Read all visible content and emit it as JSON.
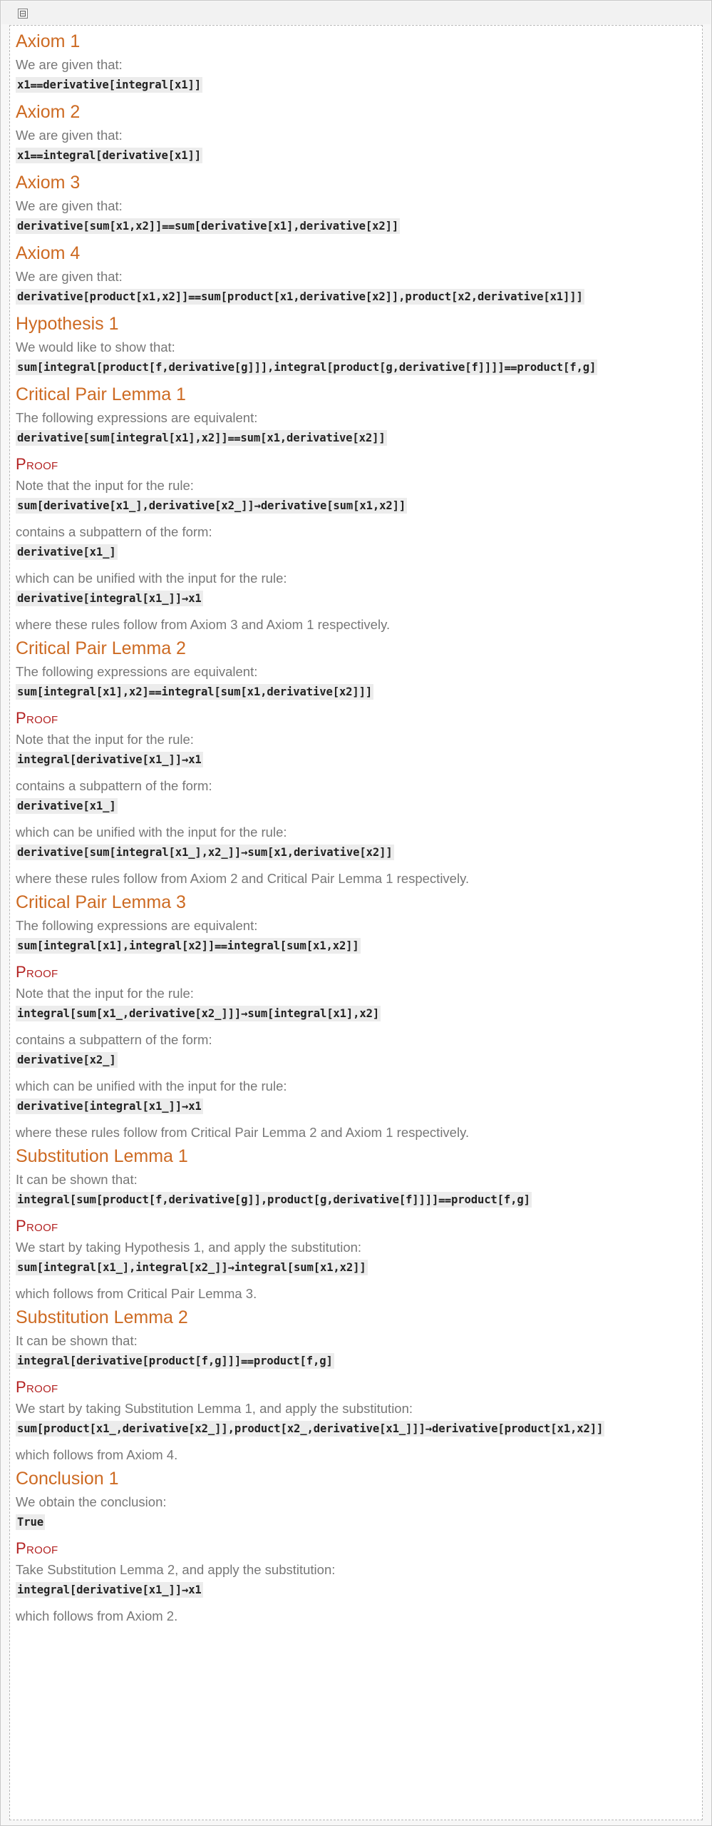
{
  "toolbar": {
    "icon": "cell-bracket-toggle-icon",
    "glyph": "⊟"
  },
  "sections": [
    {
      "title": "Axiom 1",
      "intro": "We are given that:",
      "expr": "x1⩵derivative[integral[x1]]"
    },
    {
      "title": "Axiom 2",
      "intro": "We are given that:",
      "expr": "x1⩵integral[derivative[x1]]"
    },
    {
      "title": "Axiom 3",
      "intro": "We are given that:",
      "expr": "derivative[sum[x1,x2]]⩵sum[derivative[x1],derivative[x2]]"
    },
    {
      "title": "Axiom 4",
      "intro": "We are given that:",
      "expr": "derivative[product[x1,x2]]⩵sum[product[x1,derivative[x2]],product[x2,derivative[x1]]]"
    },
    {
      "title": "Hypothesis 1",
      "intro": "We would like to show that:",
      "expr": "sum[integral[product[f,derivative[g]]],integral[product[g,derivative[f]]]]⩵product[f,g]"
    },
    {
      "title": "Critical Pair Lemma 1",
      "intro": "The following expressions are equivalent:",
      "expr": "derivative[sum[integral[x1],x2]]⩵sum[x1,derivative[x2]]",
      "proof_label": "Proof",
      "proof": [
        {
          "kind": "text",
          "value": "Note that the input for the rule:"
        },
        {
          "kind": "code",
          "value": "sum[derivative[x1_],derivative[x2_]]→derivative[sum[x1,x2]]"
        },
        {
          "kind": "text",
          "value": "contains a subpattern of the form:"
        },
        {
          "kind": "code",
          "value": "derivative[x1_]"
        },
        {
          "kind": "text",
          "value": "which can be unified with the input for the rule:"
        },
        {
          "kind": "code",
          "value": "derivative[integral[x1_]]→x1"
        },
        {
          "kind": "text",
          "value": "where these rules follow from Axiom 3 and Axiom 1 respectively."
        }
      ]
    },
    {
      "title": "Critical Pair Lemma 2",
      "intro": "The following expressions are equivalent:",
      "expr": "sum[integral[x1],x2]⩵integral[sum[x1,derivative[x2]]]",
      "proof_label": "Proof",
      "proof": [
        {
          "kind": "text",
          "value": "Note that the input for the rule:"
        },
        {
          "kind": "code",
          "value": "integral[derivative[x1_]]→x1"
        },
        {
          "kind": "text",
          "value": "contains a subpattern of the form:"
        },
        {
          "kind": "code",
          "value": "derivative[x1_]"
        },
        {
          "kind": "text",
          "value": "which can be unified with the input for the rule:"
        },
        {
          "kind": "code",
          "value": "derivative[sum[integral[x1_],x2_]]→sum[x1,derivative[x2]]"
        },
        {
          "kind": "text",
          "value": "where these rules follow from Axiom 2 and Critical Pair Lemma 1 respectively."
        }
      ]
    },
    {
      "title": "Critical Pair Lemma 3",
      "intro": "The following expressions are equivalent:",
      "expr": "sum[integral[x1],integral[x2]]⩵integral[sum[x1,x2]]",
      "proof_label": "Proof",
      "proof": [
        {
          "kind": "text",
          "value": "Note that the input for the rule:"
        },
        {
          "kind": "code",
          "value": "integral[sum[x1_,derivative[x2_]]]→sum[integral[x1],x2]"
        },
        {
          "kind": "text",
          "value": "contains a subpattern of the form:"
        },
        {
          "kind": "code",
          "value": "derivative[x2_]"
        },
        {
          "kind": "text",
          "value": "which can be unified with the input for the rule:"
        },
        {
          "kind": "code",
          "value": "derivative[integral[x1_]]→x1"
        },
        {
          "kind": "text",
          "value": "where these rules follow from Critical Pair Lemma 2 and Axiom 1 respectively."
        }
      ]
    },
    {
      "title": "Substitution Lemma 1",
      "intro": "It can be shown that:",
      "expr": "integral[sum[product[f,derivative[g]],product[g,derivative[f]]]]⩵product[f,g]",
      "proof_label": "Proof",
      "proof": [
        {
          "kind": "text",
          "value": "We start by taking Hypothesis 1, and apply the substitution:"
        },
        {
          "kind": "code",
          "value": "sum[integral[x1_],integral[x2_]]→integral[sum[x1,x2]]"
        },
        {
          "kind": "text",
          "value": "which follows from Critical Pair Lemma 3."
        }
      ]
    },
    {
      "title": "Substitution Lemma 2",
      "intro": "It can be shown that:",
      "expr": "integral[derivative[product[f,g]]]⩵product[f,g]",
      "proof_label": "Proof",
      "proof": [
        {
          "kind": "text",
          "value": "We start by taking Substitution Lemma 1, and apply the substitution:"
        },
        {
          "kind": "code",
          "value": "sum[product[x1_,derivative[x2_]],product[x2_,derivative[x1_]]]→derivative[product[x1,x2]]"
        },
        {
          "kind": "text",
          "value": "which follows from Axiom 4."
        }
      ]
    },
    {
      "title": "Conclusion 1",
      "intro": "We obtain the conclusion:",
      "expr": "True",
      "proof_label": "Proof",
      "proof": [
        {
          "kind": "text",
          "value": "Take Substitution Lemma 2, and apply the substitution:"
        },
        {
          "kind": "code",
          "value": "integral[derivative[x1_]]→x1"
        },
        {
          "kind": "text",
          "value": "which follows from Axiom 2."
        }
      ]
    }
  ],
  "colors": {
    "heading": "#cd6a22",
    "proof": "#b32222",
    "text": "#777777",
    "code_bg": "#ececec"
  }
}
